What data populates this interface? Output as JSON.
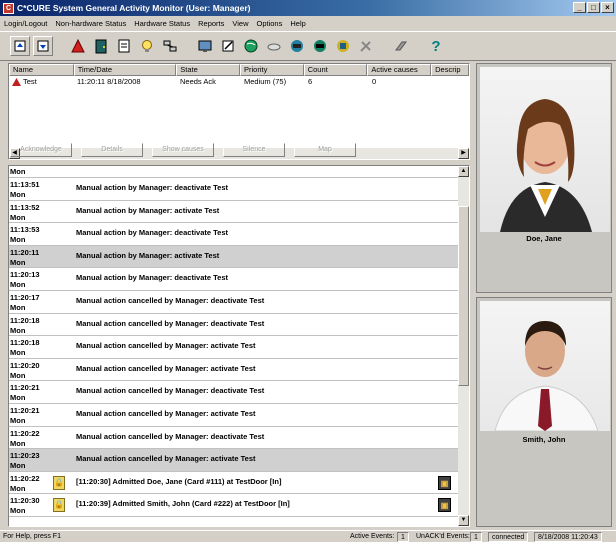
{
  "window": {
    "title": "C*CURE System General Activity Monitor (User: Manager)",
    "controls": [
      "_",
      "□",
      "×"
    ]
  },
  "menu": [
    "Login/Logout",
    "Non-hardware Status",
    "Hardware Status",
    "Reports",
    "View",
    "Options",
    "Help"
  ],
  "toolbar": {
    "help_glyph": "?"
  },
  "alarm_table": {
    "columns": [
      "Name",
      "Time/Date",
      "State",
      "Priority",
      "Count",
      "Active causes",
      "Descrip"
    ],
    "rows": [
      {
        "name": "Test",
        "time": "11:20:11 8/18/2008",
        "state": "Needs Ack",
        "priority": "Medium (75)",
        "count": "6",
        "active": "0"
      }
    ]
  },
  "action_buttons": [
    "Acknowledge",
    "Details",
    "Show causes",
    "Silence",
    "Map"
  ],
  "log": [
    {
      "time": "",
      "day": "Mon",
      "msg": "",
      "hl": false
    },
    {
      "time": "11:13:51",
      "day": "Mon",
      "msg": "Manual action by Manager: deactivate Test",
      "hl": false
    },
    {
      "time": "11:13:52",
      "day": "Mon",
      "msg": "Manual action by Manager: activate Test",
      "hl": false
    },
    {
      "time": "11:13:53",
      "day": "Mon",
      "msg": "Manual action by Manager: deactivate Test",
      "hl": false
    },
    {
      "time": "11:20:11",
      "day": "Mon",
      "msg": "Manual action by Manager: activate Test",
      "hl": true
    },
    {
      "time": "11:20:13",
      "day": "Mon",
      "msg": "Manual action by Manager: deactivate Test",
      "hl": false
    },
    {
      "time": "11:20:17",
      "day": "Mon",
      "msg": "Manual action cancelled by Manager: deactivate Test",
      "hl": false
    },
    {
      "time": "11:20:18",
      "day": "Mon",
      "msg": "Manual action cancelled by Manager: deactivate Test",
      "hl": false
    },
    {
      "time": "11:20:18",
      "day": "Mon",
      "msg": "Manual action cancelled by Manager: activate Test",
      "hl": false
    },
    {
      "time": "11:20:20",
      "day": "Mon",
      "msg": "Manual action cancelled by Manager: activate Test",
      "hl": false
    },
    {
      "time": "11:20:21",
      "day": "Mon",
      "msg": "Manual action cancelled by Manager: deactivate Test",
      "hl": false
    },
    {
      "time": "11:20:21",
      "day": "Mon",
      "msg": "Manual action cancelled by Manager: activate Test",
      "hl": false
    },
    {
      "time": "11:20:22",
      "day": "Mon",
      "msg": "Manual action cancelled by Manager: deactivate Test",
      "hl": false
    },
    {
      "time": "11:20:23",
      "day": "Mon",
      "msg": "Manual action cancelled by Manager: activate Test",
      "hl": true
    },
    {
      "time": "11:20:22",
      "day": "Mon",
      "msg": "[11:20:30] Admitted Doe, Jane (Card #111) at  TestDoor [In]",
      "hl": false,
      "lock": true
    },
    {
      "time": "11:20:30",
      "day": "Mon",
      "msg": "[11:20:39] Admitted Smith, John (Card #222) at  TestDoor [In]",
      "hl": false,
      "lock": true
    }
  ],
  "photos": [
    {
      "name": "Doe, Jane"
    },
    {
      "name": "Smith, John"
    }
  ],
  "status": {
    "help": "For Help, press F1",
    "active_label": "Active Events:",
    "active_val": "1",
    "unack_label": "UnACK'd Events:",
    "unack_val": "1",
    "conn": "connected",
    "datetime": "8/18/2008 11:20:43"
  }
}
